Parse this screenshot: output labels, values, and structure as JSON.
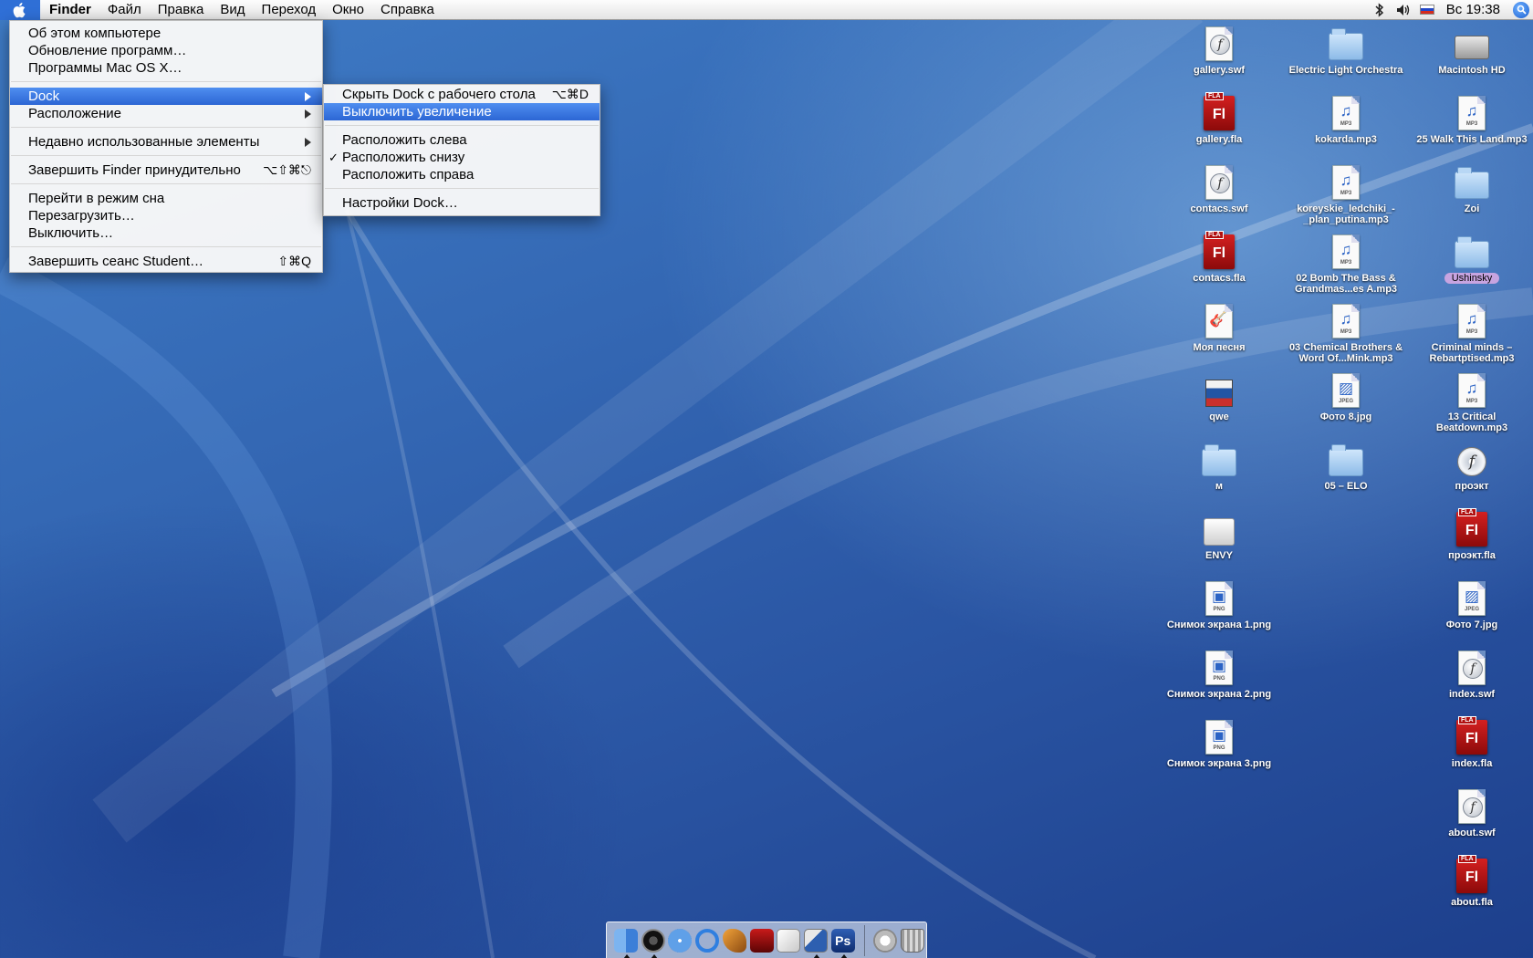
{
  "menubar": {
    "app_name": "Finder",
    "items": [
      "Файл",
      "Правка",
      "Вид",
      "Переход",
      "Окно",
      "Справка"
    ],
    "clock": "Вс 19:38"
  },
  "apple_menu": {
    "items": [
      {
        "label": "Об этом компьютере",
        "shortcut": ""
      },
      {
        "label": "Обновление программ…",
        "shortcut": ""
      },
      {
        "label": "Программы Mac OS X…",
        "shortcut": ""
      },
      {
        "label": "Dock",
        "shortcut": ""
      },
      {
        "label": "Расположение",
        "shortcut": ""
      },
      {
        "label": "Недавно использованные элементы",
        "shortcut": ""
      },
      {
        "label": "Завершить Finder принудительно",
        "shortcut": "⌥⇧⌘⎋"
      },
      {
        "label": "Перейти в режим сна",
        "shortcut": ""
      },
      {
        "label": "Перезагрузить…",
        "shortcut": ""
      },
      {
        "label": "Выключить…",
        "shortcut": ""
      },
      {
        "label": "Завершить сеанс Student…",
        "shortcut": "⇧⌘Q"
      }
    ]
  },
  "dock_menu": {
    "items": [
      {
        "label": "Скрыть Dock с рабочего стола",
        "shortcut": "⌥⌘D"
      },
      {
        "label": "Выключить увеличение",
        "shortcut": ""
      },
      {
        "label": "Расположить слева",
        "shortcut": ""
      },
      {
        "label": "Расположить снизу",
        "shortcut": ""
      },
      {
        "label": "Расположить справа",
        "shortcut": ""
      },
      {
        "label": "Настройки Dock…",
        "shortcut": ""
      }
    ],
    "checkmark": "✓"
  },
  "desktop": {
    "col1": [
      "gallery.swf",
      "gallery.fla",
      "contacs.swf",
      "contacs.fla",
      "Моя песня",
      "qwe",
      "м",
      "ENVY",
      "Снимок экрана 1.png",
      "Снимок экрана 2.png",
      "Снимок экрана 3.png"
    ],
    "col2": [
      "Electric Light Orchestra",
      "kokarda.mp3",
      "koreyskie_ledchiki_-_plan_putina.mp3",
      "02 Bomb The Bass & Grandmas...es A.mp3",
      "03 Chemical Brothers & Word Of...Mink.mp3",
      "Фото 8.jpg",
      "05 – ELO"
    ],
    "col3": [
      "Macintosh HD",
      "25 Walk This Land.mp3",
      "Zoi",
      "Ushinsky",
      "Criminal minds – Rebartptised.mp3",
      "13 Critical Beatdown.mp3",
      "проэкт",
      "проэкт.fla",
      "Фото 7.jpg",
      "index.swf",
      "index.fla",
      "about.swf",
      "about.fla"
    ]
  },
  "icon_text": {
    "fla_tag": "FLA",
    "fla_letters": "Fl",
    "swf_letter": "f",
    "mp3_tag": "MP3",
    "png_tag": "PNG",
    "jpeg_tag": "JPEG",
    "dock_ps": "Ps"
  }
}
